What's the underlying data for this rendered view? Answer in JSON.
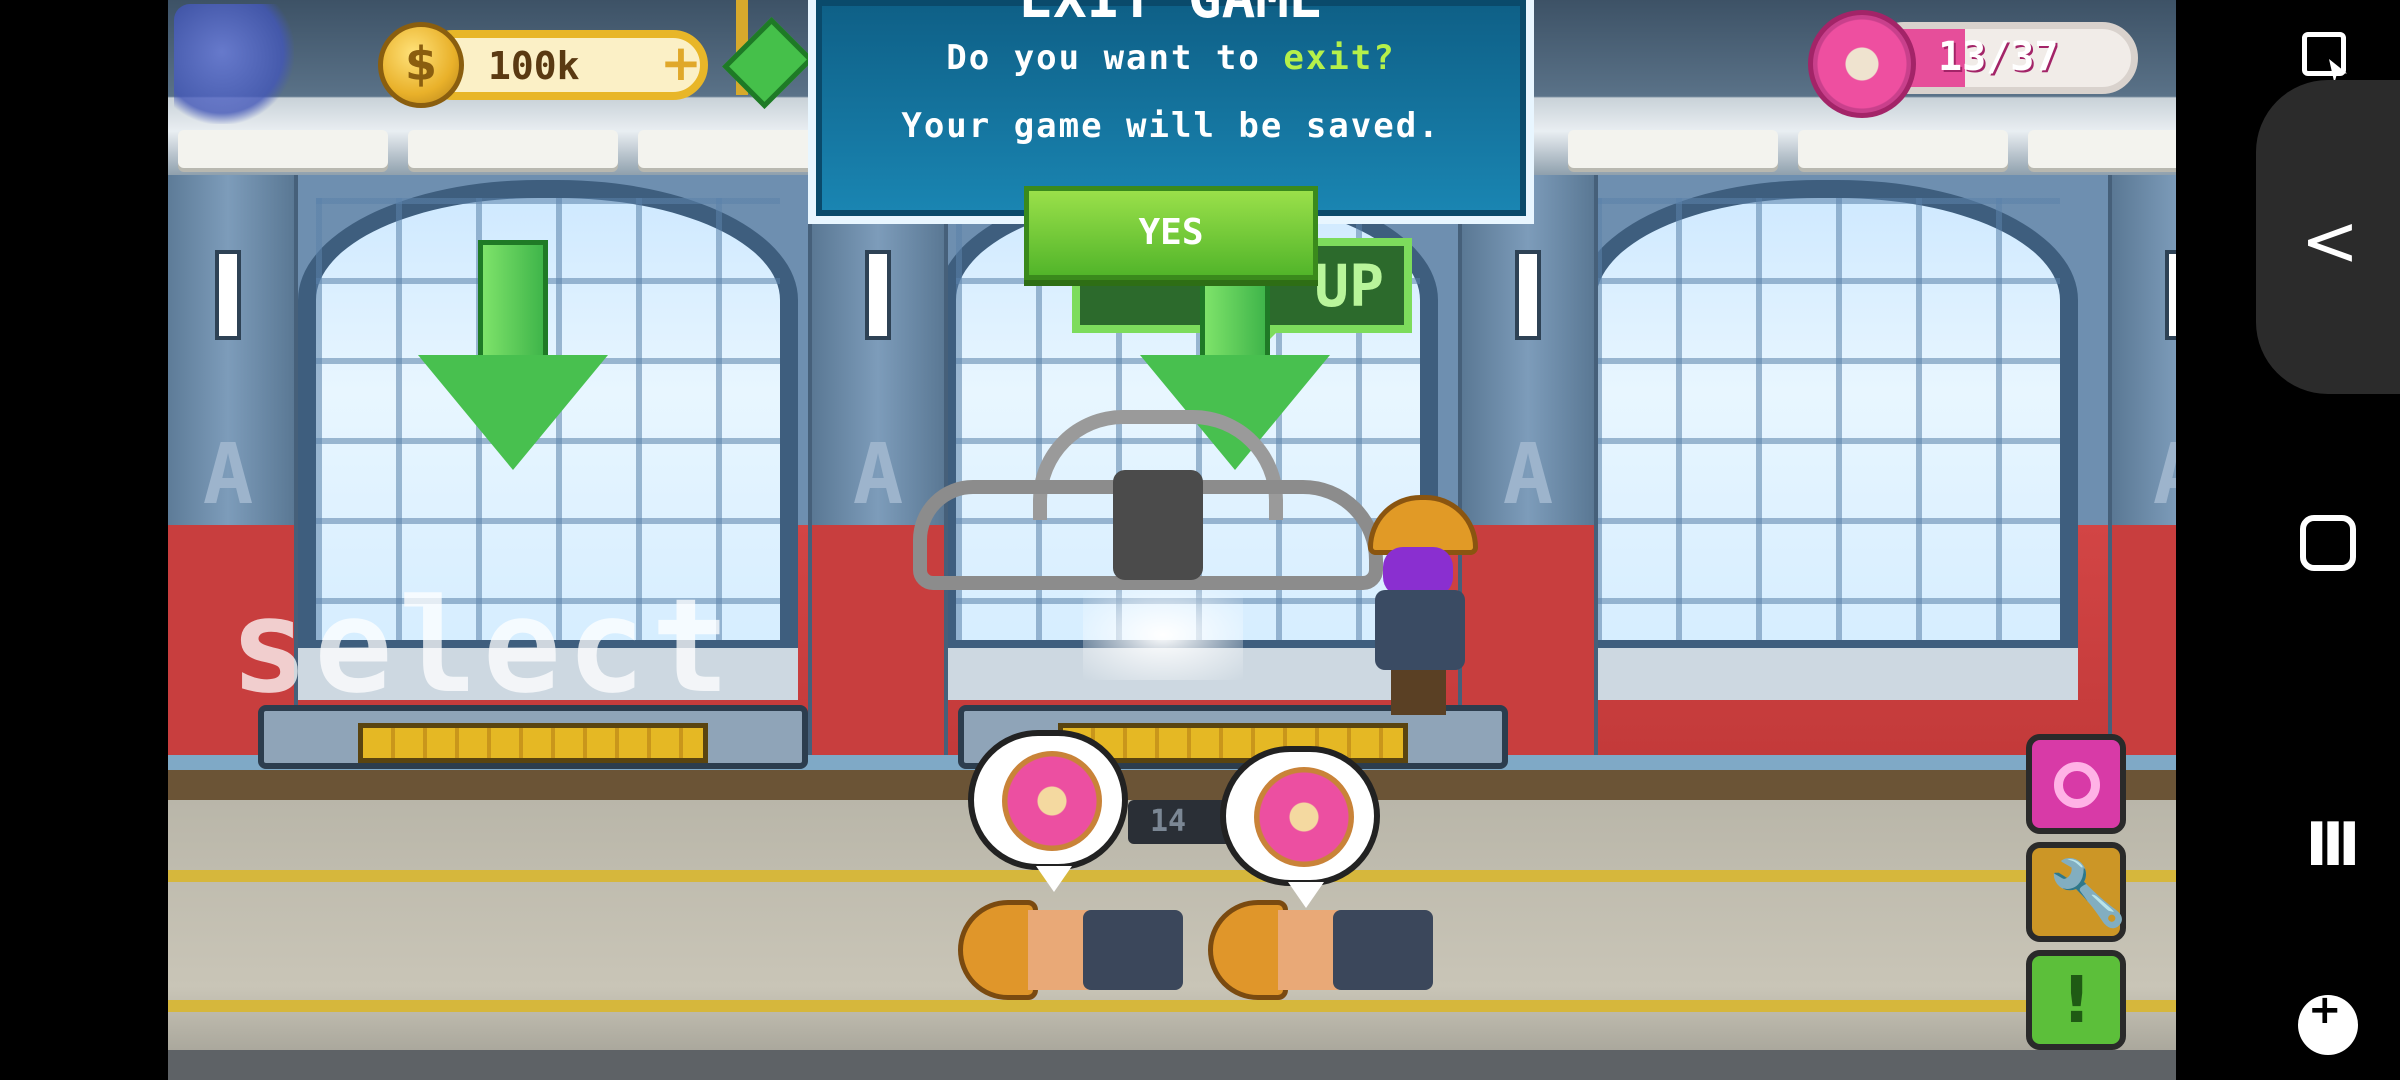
{
  "hud": {
    "money_value": "100k",
    "money_plus": "+",
    "coin_symbol": "$",
    "donut_count": "13/37",
    "donut_progress": 0.35
  },
  "dialog": {
    "title": "EXIT GAME",
    "question_prefix": "Do you want to ",
    "question_highlight": "exit?",
    "message": "Your game will be saved.",
    "yes_label": "YES"
  },
  "scene": {
    "select_label": "select",
    "sign_label": "UP",
    "counter_tag": "14",
    "pillar_letter": "A",
    "side_buttons": {
      "wrench": "🔧",
      "alert": "!"
    }
  },
  "system_nav": {
    "back": "<",
    "recent": "III"
  },
  "colors": {
    "accent_green": "#52b52a",
    "donut_pink": "#e64e9a",
    "dialog_blue": "#1a86b3",
    "coin_gold": "#e9b12a"
  }
}
